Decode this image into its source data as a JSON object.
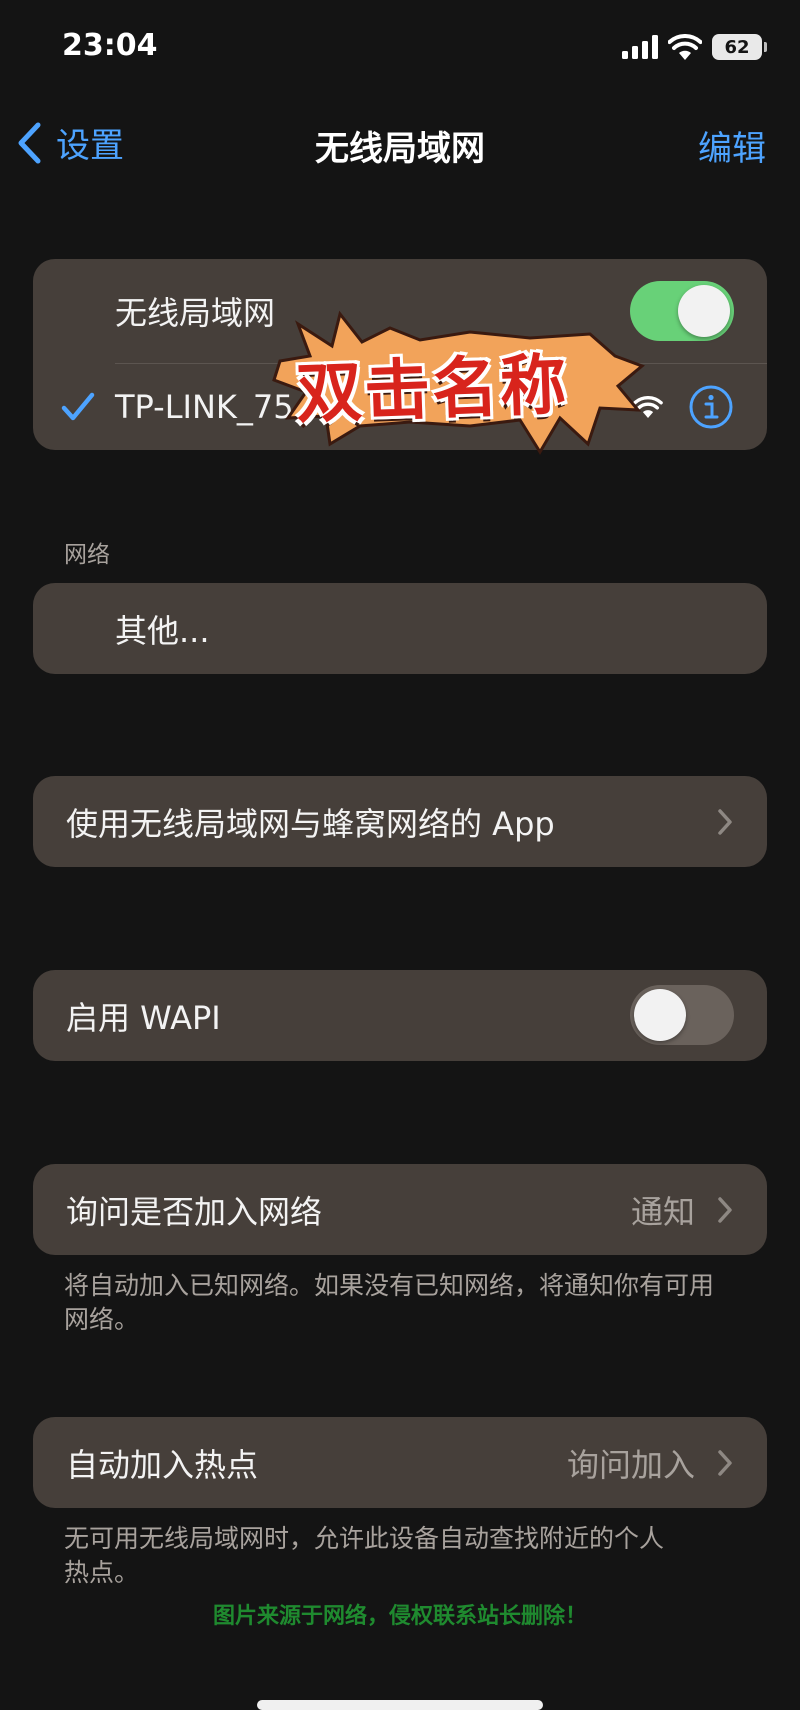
{
  "status_bar": {
    "time": "23:04",
    "battery": "62"
  },
  "nav": {
    "back_label": "设置",
    "title": "无线局域网",
    "edit_label": "编辑"
  },
  "wifi_card": {
    "toggle_label": "无线局域网",
    "toggle_on": true,
    "connected_network": "TP-LINK_75"
  },
  "overlay_sticker": "双击名称",
  "networks_section": {
    "header": "网络",
    "other_label": "其他..."
  },
  "apps_row": {
    "label": "使用无线局域网与蜂窝网络的 App"
  },
  "wapi_row": {
    "label": "启用 WAPI",
    "toggle_on": false
  },
  "ask_join_row": {
    "label": "询问是否加入网络",
    "value": "通知",
    "footnote": "将自动加入已知网络。如果没有已知网络，将通知你有可用网络。"
  },
  "hotspot_row": {
    "label": "自动加入热点",
    "value": "询问加入",
    "footnote": "无可用无线局域网时，允许此设备自动查找附近的个人热点。"
  },
  "watermark": "图片来源于网络，侵权联系站长删除！",
  "colors": {
    "accent": "#4da3ff",
    "toggle_on": "#68d178",
    "card": "#463f3a",
    "background": "#141414",
    "watermark": "#1f8a2f"
  }
}
